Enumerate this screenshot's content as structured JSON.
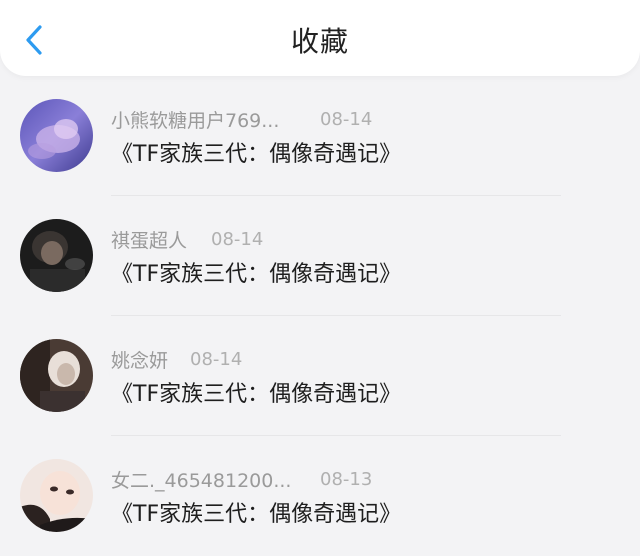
{
  "header": {
    "title": "收藏",
    "back_icon": "chevron-left-icon",
    "accent_color": "#2d9bf0"
  },
  "favorites": [
    {
      "username": "小熊软糖用户769...",
      "date": "08-14",
      "content": "《TF家族三代：偶像奇遇记》",
      "avatar_icon": "user-avatar-photo"
    },
    {
      "username": "祺蛋超人",
      "date": "08-14",
      "content": "《TF家族三代：偶像奇遇记》",
      "avatar_icon": "user-avatar-photo"
    },
    {
      "username": "姚念妍",
      "date": "08-14",
      "content": "《TF家族三代：偶像奇遇记》",
      "avatar_icon": "user-avatar-photo"
    },
    {
      "username": "女二._465481200...",
      "date": "08-13",
      "content": "《TF家族三代：偶像奇遇记》",
      "avatar_icon": "user-avatar-photo"
    }
  ]
}
